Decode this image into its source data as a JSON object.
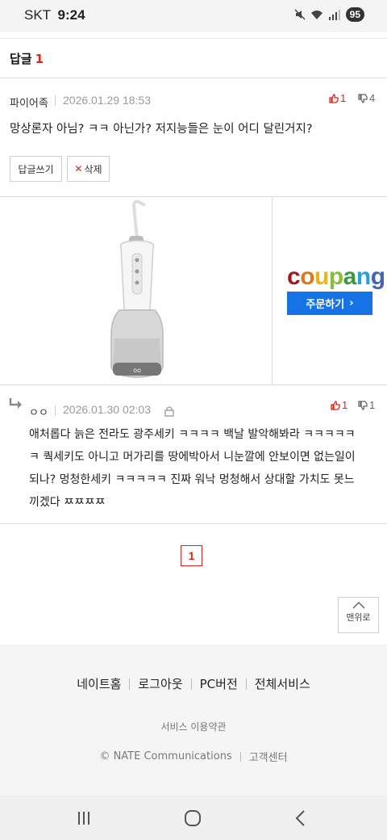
{
  "status_bar": {
    "carrier": "SKT",
    "time": "9:24",
    "battery": "95",
    "icons": [
      "mute-icon",
      "wifi-icon",
      "signal-icon"
    ]
  },
  "replies_header": {
    "label": "답글",
    "count": "1"
  },
  "comment": {
    "author": "파이어족",
    "date": "2026.01.29 18:53",
    "upvotes": "1",
    "downvotes": "4",
    "text": "망상론자 아님? ㅋㅋ 아닌가? 저지능들은 눈이 어디 달린거지?",
    "reply_button": "답글쓰기",
    "delete_button": "삭제"
  },
  "ad": {
    "brand": "coupang",
    "order_label": "주문하기",
    "colors": [
      "#9e1d1f",
      "#d97a1c",
      "#e8b51b",
      "#8cbd3a",
      "#3a9a3f",
      "#26a2d9",
      "#4366b1"
    ]
  },
  "reply": {
    "author": "ㅇㅇ",
    "date": "2026.01.30 02:03",
    "upvotes": "1",
    "downvotes": "1",
    "line1": "애처롭다 늙은 전라도 광주세키 ㅋㅋㅋㅋ 백날 발악해봐라 ㅋㅋㅋㅋㅋ",
    "line2": "ㅋ 쿽세키도 아니고 머가리를 땅에박아서 니눈깔에 안보이면 없는일이",
    "line3": "되나? 멍청한세키 ㅋㅋㅋㅋㅋ 진짜 워낙 멍청해서 상대할 가치도 못느",
    "line4": "끼겠다 ㅉㅉㅉㅉ"
  },
  "pagination": {
    "current": "1"
  },
  "to_top": {
    "label": "맨위로"
  },
  "footer": {
    "links": [
      "네이트홈",
      "로그아웃",
      "PC버전",
      "전체서비스"
    ],
    "terms": "서비스 이용약관",
    "copyright": "© NATE Communications",
    "support": "고객센터"
  },
  "accent_color": "#e2231a"
}
